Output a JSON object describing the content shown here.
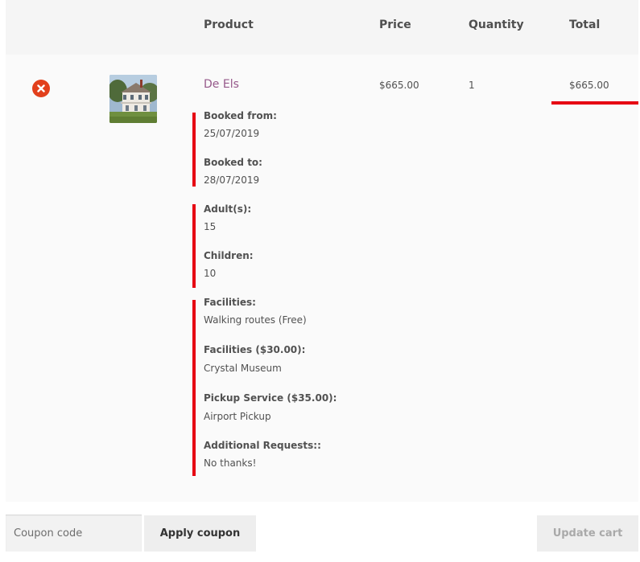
{
  "table": {
    "headers": {
      "product": "Product",
      "price": "Price",
      "quantity": "Quantity",
      "total": "Total"
    }
  },
  "item": {
    "name": "De Els",
    "price": "$665.00",
    "quantity": "1",
    "total": "$665.00",
    "remove_icon": "close-icon",
    "thumbnail": "house-photo",
    "meta": [
      {
        "label": "Booked from:",
        "value": "25/07/2019"
      },
      {
        "label": "Booked to:",
        "value": "28/07/2019"
      },
      {
        "label": "Adult(s):",
        "value": "15"
      },
      {
        "label": "Children:",
        "value": "10"
      },
      {
        "label": "Facilities:",
        "value": "Walking routes (Free)"
      },
      {
        "label": "Facilities ($30.00):",
        "value": "Crystal Museum"
      },
      {
        "label": "Pickup Service ($35.00):",
        "value": "Airport Pickup"
      },
      {
        "label": "Additional Requests::",
        "value": "No thanks!"
      }
    ]
  },
  "actions": {
    "coupon_placeholder": "Coupon code",
    "apply_label": "Apply coupon",
    "update_label": "Update cart"
  },
  "colors": {
    "link": "#96588a",
    "remove": "#e2401c",
    "highlight": "#e60012"
  }
}
